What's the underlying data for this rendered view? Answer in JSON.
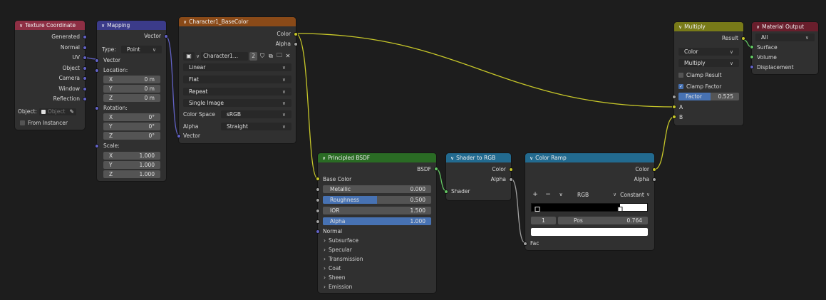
{
  "colors": {
    "background": "#1d1d1d",
    "node_body": "#303030",
    "header_input": "#8e2f44",
    "header_vector": "#3b3b8a",
    "header_texture": "#8a4a18",
    "header_shader": "#2a6b24",
    "header_converter": "#226a8f",
    "header_color": "#787a18",
    "header_output": "#691e2c",
    "socket_vector": "#6363c7",
    "socket_color": "#c7c729",
    "socket_float": "#a1a1a1",
    "socket_shader": "#63c763",
    "accent_blue": "#4772b3",
    "wire_color": "#c7c729",
    "wire_vector": "#6363c7"
  },
  "texcoord": {
    "title": "Texture Coordinate",
    "outputs": [
      "Generated",
      "Normal",
      "UV",
      "Object",
      "Camera",
      "Window",
      "Reflection"
    ],
    "object_label": "Object:",
    "object_placeholder": "Object",
    "from_instancer": "From Instancer"
  },
  "mapping": {
    "title": "Mapping",
    "output": "Vector",
    "type_label": "Type:",
    "type_value": "Point",
    "vector_input": "Vector",
    "location_label": "Location:",
    "location": [
      {
        "axis": "X",
        "value": "0 m"
      },
      {
        "axis": "Y",
        "value": "0 m"
      },
      {
        "axis": "Z",
        "value": "0 m"
      }
    ],
    "rotation_label": "Rotation:",
    "rotation": [
      {
        "axis": "X",
        "value": "0°"
      },
      {
        "axis": "Y",
        "value": "0°"
      },
      {
        "axis": "Z",
        "value": "0°"
      }
    ],
    "scale_label": "Scale:",
    "scale": [
      {
        "axis": "X",
        "value": "1.000"
      },
      {
        "axis": "Y",
        "value": "1.000"
      },
      {
        "axis": "Z",
        "value": "1.000"
      }
    ]
  },
  "imagetex": {
    "title": "Character1_BaseColor",
    "outputs": [
      "Color",
      "Alpha"
    ],
    "image_name": "Character1...",
    "users": "2",
    "interpolation": "Linear",
    "projection": "Flat",
    "extension": "Repeat",
    "source": "Single Image",
    "colorspace_label": "Color Space",
    "colorspace_value": "sRGB",
    "alpha_label": "Alpha",
    "alpha_value": "Straight",
    "vector_input": "Vector"
  },
  "bsdf": {
    "title": "Principled BSDF",
    "output": "BSDF",
    "base_color": "Base Color",
    "fields": [
      {
        "label": "Metallic",
        "value": "0.000",
        "fill": 0.0
      },
      {
        "label": "Roughness",
        "value": "0.500",
        "fill": 0.5
      },
      {
        "label": "IOR",
        "value": "1.500",
        "fill": 0.0
      },
      {
        "label": "Alpha",
        "value": "1.000",
        "fill": 1.0
      }
    ],
    "normal": "Normal",
    "panels": [
      "Subsurface",
      "Specular",
      "Transmission",
      "Coat",
      "Sheen",
      "Emission"
    ]
  },
  "shader2rgb": {
    "title": "Shader to RGB",
    "outputs": [
      "Color",
      "Alpha"
    ],
    "input": "Shader"
  },
  "colorramp": {
    "title": "Color Ramp",
    "outputs": [
      "Color",
      "Alpha"
    ],
    "add": "+",
    "remove": "−",
    "mode": "RGB",
    "interp": "Constant",
    "stop_index": "1",
    "pos_label": "Pos",
    "pos_value": "0.764",
    "stop_positions": [
      0.055,
      0.764
    ],
    "input": "Fac"
  },
  "multiply": {
    "title": "Multiply",
    "output": "Result",
    "data_type": "Color",
    "blend": "Multiply",
    "clamp_result": "Clamp Result",
    "clamp_result_checked": false,
    "clamp_factor": "Clamp Factor",
    "clamp_factor_checked": true,
    "factor_label": "Factor",
    "factor_value": "0.525",
    "inputs": [
      "A",
      "B"
    ]
  },
  "matout": {
    "title": "Material Output",
    "target": "All",
    "inputs": [
      "Surface",
      "Volume",
      "Displacement"
    ]
  }
}
